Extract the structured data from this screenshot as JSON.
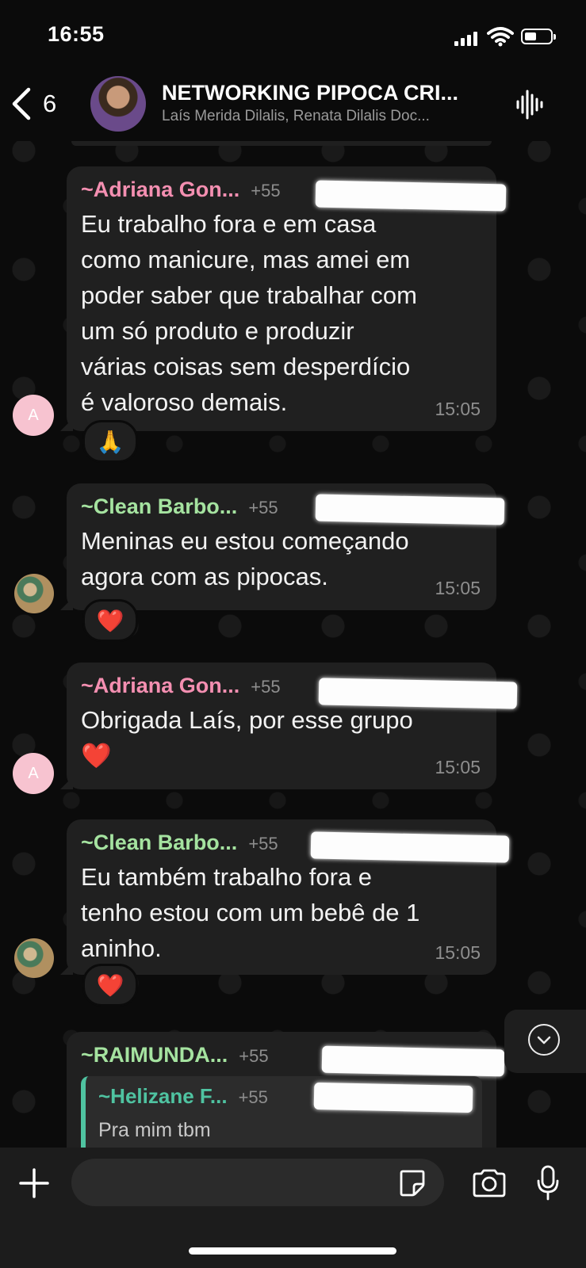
{
  "status_bar": {
    "time": "16:55"
  },
  "header": {
    "back_count": "6",
    "title": "NETWORKING PIPOCA CRI...",
    "subtitle": "Laís Merida Dilalis, Renata Dilalis Doc..."
  },
  "messages": [
    {
      "sender": "~Adriana Gon...",
      "sender_color": "#f48fb1",
      "phone": "+55",
      "text": "Eu trabalho fora e em casa\ncomo manicure, mas amei em\npoder saber que trabalhar com\num só produto e produzir\nvárias coisas sem desperdício\né valoroso demais.",
      "time": "15:05",
      "avatar_letter": "A",
      "reaction": "🙏"
    },
    {
      "sender": "~Clean Barbo...",
      "sender_color": "#a5e3a0",
      "phone": "+55",
      "text": "Meninas eu estou começando\nagora com as pipocas.",
      "time": "15:05",
      "reaction": "❤️"
    },
    {
      "sender": "~Adriana Gon...",
      "sender_color": "#f48fb1",
      "phone": "+55",
      "text": "Obrigada Laís, por esse grupo\n❤️",
      "time": "15:05",
      "avatar_letter": "A"
    },
    {
      "sender": "~Clean Barbo...",
      "sender_color": "#a5e3a0",
      "phone": "+55",
      "text": "Eu também trabalho fora e\ntenho estou com um bebê de 1\naninho.",
      "time": "15:05",
      "reaction": "❤️"
    },
    {
      "sender": "~RAIMUNDA...",
      "sender_color": "#a5e3a0",
      "phone": "+55",
      "quote": {
        "sender": "~Helizane F...",
        "sender_color": "#4fc3a1",
        "phone": "+55",
        "text": "Pra mim tbm"
      }
    }
  ],
  "input": {
    "placeholder": ""
  },
  "icons": {
    "back": "chevron-left-icon",
    "audio": "waveform-icon",
    "plus": "plus-icon",
    "sticker": "sticker-icon",
    "camera": "camera-icon",
    "mic": "microphone-icon",
    "scroll": "chevron-down-icon"
  }
}
